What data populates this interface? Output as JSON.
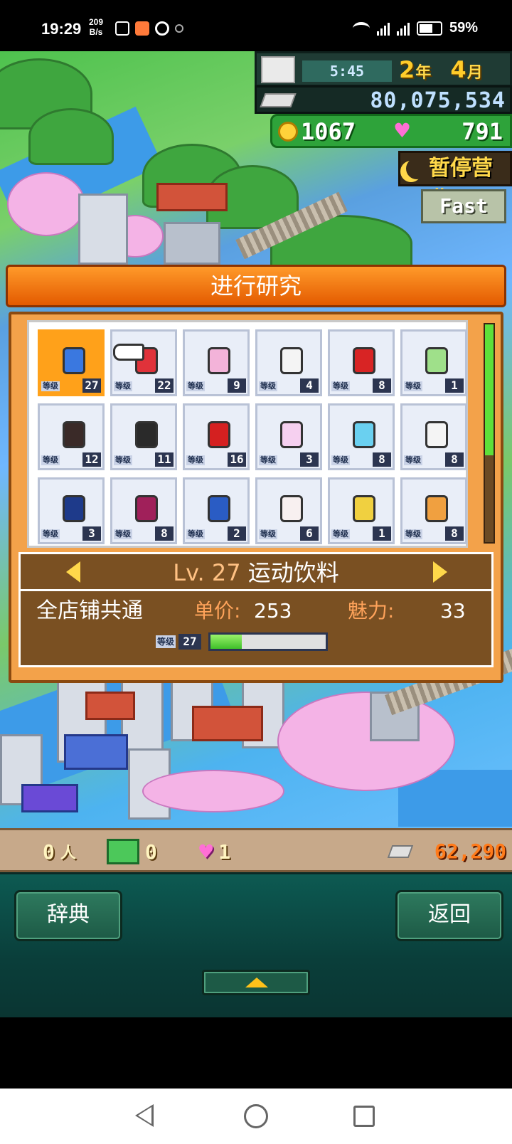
{
  "status_bar": {
    "time": "19:29",
    "net_speed_value": "209",
    "net_speed_unit": "B/s",
    "battery": "59%"
  },
  "hud": {
    "time": "5:45",
    "year": "2",
    "year_unit": "年",
    "month": "4",
    "month_unit": "月",
    "money": "80,075,534",
    "coins": "1067",
    "hearts": "791",
    "pause_label": "暂停营业",
    "fast_label": "Fast"
  },
  "dialog": {
    "title": "进行研究",
    "level_tag": "等级",
    "items": [
      {
        "level": "27",
        "color": "#3a78e0",
        "selected": true
      },
      {
        "level": "22",
        "color": "#e0323a",
        "selected": false
      },
      {
        "level": "9",
        "color": "#f3b3d9",
        "selected": false
      },
      {
        "level": "4",
        "color": "#f4f4f4",
        "selected": false
      },
      {
        "level": "8",
        "color": "#d82424",
        "selected": false
      },
      {
        "level": "1",
        "color": "#9fe08a",
        "selected": false
      },
      {
        "level": "12",
        "color": "#3a2a28",
        "selected": false
      },
      {
        "level": "11",
        "color": "#2a2a2a",
        "selected": false
      },
      {
        "level": "16",
        "color": "#d42020",
        "selected": false
      },
      {
        "level": "3",
        "color": "#f6d0f0",
        "selected": false
      },
      {
        "level": "8",
        "color": "#6ad0f0",
        "selected": false
      },
      {
        "level": "8",
        "color": "#f4f4f4",
        "selected": false
      },
      {
        "level": "3",
        "color": "#1e3a8a",
        "selected": false
      },
      {
        "level": "8",
        "color": "#a0205a",
        "selected": false
      },
      {
        "level": "2",
        "color": "#2a5cc4",
        "selected": false
      },
      {
        "level": "6",
        "color": "#f8f0f0",
        "selected": false
      },
      {
        "level": "1",
        "color": "#f0d040",
        "selected": false
      },
      {
        "level": "8",
        "color": "#f0a040",
        "selected": false
      }
    ],
    "scroll_position": 0.6,
    "info": {
      "level_prefix": "Lv. 27",
      "name": "运动饮料",
      "shop": "全店铺共通",
      "price_label": "单价:",
      "price": "253",
      "charm_label": "魅力:",
      "charm": "33",
      "exp_level_tag": "等级",
      "exp_level": "27",
      "exp_progress": 0.27
    }
  },
  "bottom_strip": {
    "people": "0",
    "people_unit": "人",
    "gifts": "0",
    "hearts": "1",
    "money": "62,290"
  },
  "bottom_panel": {
    "dict_label": "辞典",
    "back_label": "返回"
  }
}
